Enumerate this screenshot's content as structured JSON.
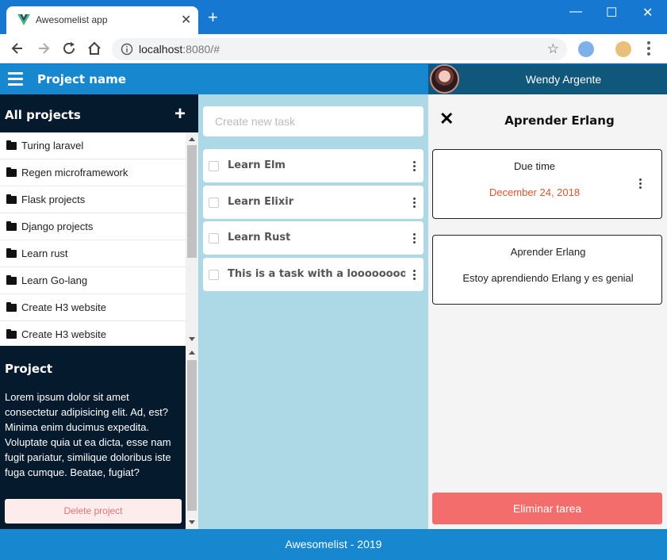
{
  "browser": {
    "tab_title": "Awesomelist app",
    "tab_close": "✕",
    "new_tab": "+",
    "url_host": "localhost",
    "url_rest": ":8080/#",
    "minimize": "—",
    "maximize": "☐",
    "close": "✕",
    "star": "☆"
  },
  "header": {
    "project_name": "Project name",
    "user_name": "Wendy Argente"
  },
  "sidebar": {
    "title": "All projects",
    "add_label": "+",
    "projects": [
      "Turing laravel",
      "Regen microframework",
      "Flask projects",
      "Django projects",
      "Learn rust",
      "Learn Go-lang",
      "Create H3 website",
      "Create H3 website"
    ],
    "project_title": "Project",
    "project_description": "Lorem ipsum dolor sit amet consectetur adipisicing elit. Ad, est? Minima enim ducimus expedita. Voluptate quia ut ea dicta, esse nam fugit pariatur, similique doloribus iste fuga cumque. Beatae, fugiat?",
    "delete_project": "Delete project"
  },
  "tasks": {
    "placeholder": "Create new task",
    "items": [
      "Learn Elm",
      "Learn Elixir",
      "Learn Rust",
      "This is a task with a looooooooooooooooong name"
    ]
  },
  "detail": {
    "close": "✕",
    "title": "Aprender Erlang",
    "due_label": "Due time",
    "due_value": "December 24, 2018",
    "card_title": "Aprender Erlang",
    "card_text": "Estoy aprendiendo Erlang y es genial",
    "delete_task": "Eliminar tarea"
  },
  "footer": {
    "text": "Awesomelist - 2019"
  },
  "colors": {
    "browser_blue": "#1778d2",
    "header_blue": "#1787d0",
    "user_header": "#11567b",
    "sidebar_dark": "#051a2c",
    "tasks_bg": "#add8e6",
    "due_date": "#e0552f",
    "delete_red": "#f36d6d"
  }
}
